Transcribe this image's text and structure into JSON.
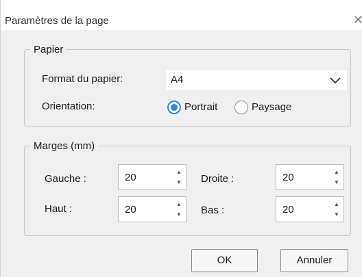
{
  "window": {
    "title": "Paramètres de la page",
    "close_icon": "close-icon",
    "close_glyph": "✕"
  },
  "paper": {
    "group_label": "Papier",
    "format_label": "Format du papier:",
    "format_value": "A4",
    "orientation_label": "Orientation:",
    "orientation_options": [
      "Portrait",
      "Paysage"
    ],
    "orientation_selected": "Portrait"
  },
  "margins": {
    "group_label": "Marges (mm)",
    "left_label": "Gauche :",
    "left_value": "20",
    "right_label": "Droite :",
    "right_value": "20",
    "top_label": "Haut :",
    "top_value": "20",
    "bottom_label": "Bas :",
    "bottom_value": "20"
  },
  "buttons": {
    "ok_label": "OK",
    "cancel_label": "Annuler"
  },
  "colors": {
    "accent": "#2a8dd4",
    "dialog_background": "#f0f0f0"
  }
}
